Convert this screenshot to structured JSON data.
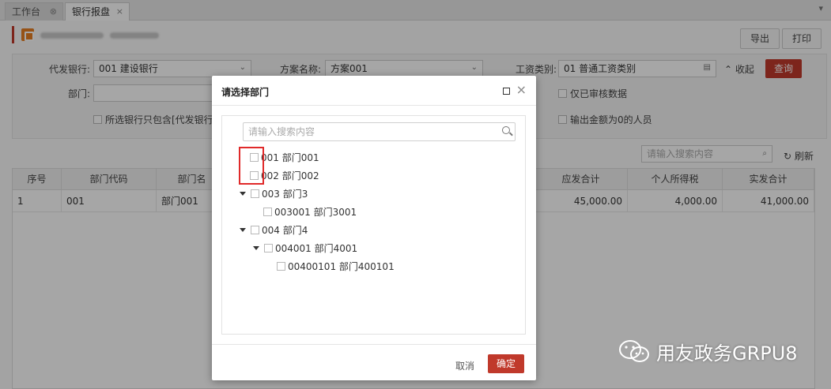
{
  "tabs": [
    {
      "label": "工作台"
    },
    {
      "label": "银行报盘"
    }
  ],
  "toolbar": {
    "export_label": "导出",
    "print_label": "打印"
  },
  "filters": {
    "bank_label": "代发银行:",
    "bank_value": "001 建设银行",
    "plan_label": "方案名称:",
    "plan_value": "方案001",
    "wage_label": "工资类别:",
    "wage_value": "01 普通工资类别",
    "collapse_label": "收起",
    "query_label": "查询",
    "dept_label": "部门:",
    "reviewed_only_label": "仅已审核数据",
    "bank_only_label": "所选银行只包含[代发银行]",
    "zero_label": "输出金额为0的人员"
  },
  "table_toolbar": {
    "search_placeholder": "请输入搜索内容",
    "refresh_label": "刷新"
  },
  "table": {
    "columns": [
      "序号",
      "部门代码",
      "部门名",
      "应发合计",
      "个人所得税",
      "实发合计"
    ],
    "rows": [
      {
        "index": "1",
        "dept_code": "001",
        "dept_name": "部门001",
        "gross": "45,000.00",
        "tax": "4,000.00",
        "net": "41,000.00"
      }
    ]
  },
  "dialog": {
    "title": "请选择部门",
    "search_placeholder": "请输入搜索内容",
    "tree": [
      {
        "label": "001 部门001"
      },
      {
        "label": "002 部门002"
      },
      {
        "label": "003 部门3"
      },
      {
        "label": "003001 部门3001"
      },
      {
        "label": "004 部门4"
      },
      {
        "label": "004001 部门4001"
      },
      {
        "label": "00400101 部门400101"
      }
    ],
    "cancel_label": "取消",
    "ok_label": "确定"
  },
  "watermark": "用友政务GRPU8",
  "colors": {
    "accent": "#c0392b",
    "highlight_box": "#e02a2a"
  }
}
